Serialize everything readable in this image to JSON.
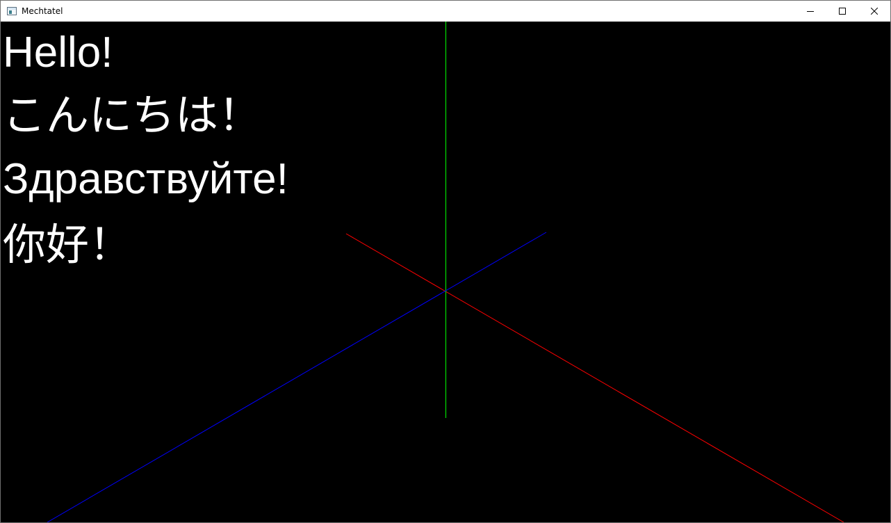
{
  "window": {
    "title": "Mechtatel",
    "icon": "app-window-icon"
  },
  "caption_buttons": {
    "minimize": "minimize-icon",
    "maximize": "maximize-icon",
    "close": "close-icon"
  },
  "scene": {
    "background": "#000000",
    "text_color": "#ffffff",
    "greetings": {
      "english": "Hello!",
      "japanese": "こんにちは！",
      "russian": "Здравствуйте!",
      "chinese": "你好！"
    },
    "axes": {
      "x_color": "#ff0000",
      "y_color": "#00ff00",
      "z_color": "#0000ff"
    }
  }
}
